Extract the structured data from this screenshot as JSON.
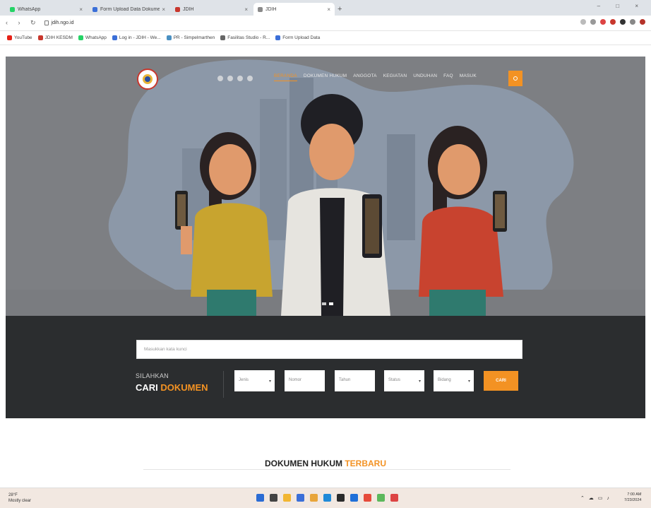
{
  "browser": {
    "tabs": [
      {
        "title": "WhatsApp",
        "color": "#25d366",
        "active": false
      },
      {
        "title": "Form Upload Data Dokumen",
        "color": "#3b6fd8",
        "active": false
      },
      {
        "title": "JDIH",
        "color": "#c8372d",
        "active": false
      },
      {
        "title": "JDIH",
        "color": "#8a8a8a",
        "active": true
      }
    ],
    "new_tab": "+",
    "window_controls": "–  □  ×",
    "url": "jdih.ngo.id",
    "bookmarks": [
      {
        "label": "YouTube",
        "color": "#e62117"
      },
      {
        "label": "JDIH KESDM",
        "color": "#c8372d"
      },
      {
        "label": "WhatsApp",
        "color": "#25d366"
      },
      {
        "label": "Log in - JDIH - We...",
        "color": "#3b6fd8"
      },
      {
        "label": "PR - Simpelmarthen",
        "color": "#4a90c2"
      },
      {
        "label": "Fasilitas Studio - R...",
        "color": "#666666"
      },
      {
        "label": "Form Upload Data",
        "color": "#3b6fd8"
      }
    ]
  },
  "site": {
    "menu": [
      {
        "label": "BERANDA",
        "active": true
      },
      {
        "label": "DOKUMEN HUKUM",
        "active": false
      },
      {
        "label": "ANGGOTA",
        "active": false
      },
      {
        "label": "KEGIATAN",
        "active": false
      },
      {
        "label": "UNDUHAN",
        "active": false
      },
      {
        "label": "FAQ",
        "active": false
      },
      {
        "label": "MASUK",
        "active": false
      }
    ],
    "search": {
      "keyword_placeholder": "Masukkan kata kunci",
      "heading_small": "SILAHKAN",
      "heading_main": "CARI",
      "heading_accent": "DOKUMEN",
      "filters": [
        {
          "label": "Jenis",
          "has_arrow": true
        },
        {
          "label": "Nomor",
          "has_arrow": false
        },
        {
          "label": "Tahun",
          "has_arrow": false
        },
        {
          "label": "Status",
          "has_arrow": true
        },
        {
          "label": "Bidang",
          "has_arrow": true
        }
      ],
      "button": "CARI"
    },
    "latest": {
      "title_main": "DOKUMEN HUKUM",
      "title_accent": "TERBARU"
    }
  },
  "taskbar": {
    "weather_temp": "28°F",
    "weather_desc": "Mostly clear",
    "time": "7:00 AM",
    "date": "7/23/2024",
    "app_colors": [
      "#2b6cd4",
      "#444444",
      "#f2b632",
      "#3b6fd8",
      "#e8a53a",
      "#1f8ad8",
      "#2b2b2b",
      "#1f6fd8",
      "#e64b3b",
      "#5cb85c",
      "#d44"
    ]
  },
  "colors": {
    "accent": "#f39223",
    "hero_bg": "#7d7f83",
    "panel_bg": "#2b2d2f"
  }
}
